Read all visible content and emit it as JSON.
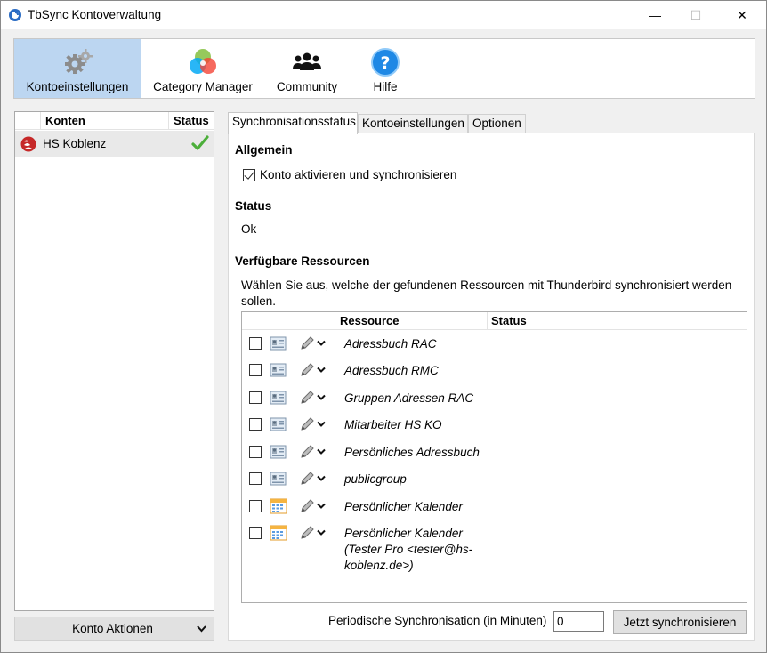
{
  "window": {
    "title": "TbSync Kontoverwaltung",
    "controls": {
      "minimize": "—",
      "maximize": "☐",
      "close": "✕"
    }
  },
  "toolbar": {
    "items": [
      {
        "label": "Kontoeinstellungen",
        "icon": "gears-icon",
        "active": true
      },
      {
        "label": "Category Manager",
        "icon": "color-circles-icon",
        "active": false
      },
      {
        "label": "Community",
        "icon": "people-icon",
        "active": false
      },
      {
        "label": "Hilfe",
        "icon": "help-icon",
        "active": false
      }
    ]
  },
  "accounts": {
    "columns": {
      "name": "Konten",
      "status": "Status"
    },
    "rows": [
      {
        "name": "HS Koblenz",
        "status_icon": "checkmark-icon"
      }
    ],
    "actions_label": "Konto Aktionen"
  },
  "tabs": [
    {
      "label": "Synchronisationsstatus",
      "selected": true
    },
    {
      "label": "Kontoeinstellungen",
      "selected": false
    },
    {
      "label": "Optionen",
      "selected": false
    }
  ],
  "sync": {
    "general_heading": "Allgemein",
    "enable_label": "Konto aktivieren und synchronisieren",
    "enable_checked": true,
    "status_heading": "Status",
    "status_value": "Ok",
    "resources_heading": "Verfügbare Ressourcen",
    "resources_hint": "Wählen Sie aus, welche der gefundenen Ressourcen mit Thunderbird synchronisiert werden sollen.",
    "columns": {
      "resource": "Ressource",
      "status": "Status"
    },
    "resources": [
      {
        "name": "Adressbuch RAC",
        "type": "addressbook-icon",
        "checked": false
      },
      {
        "name": "Adressbuch RMC",
        "type": "addressbook-icon",
        "checked": false
      },
      {
        "name": "Gruppen Adressen RAC",
        "type": "addressbook-icon",
        "checked": false
      },
      {
        "name": "Mitarbeiter HS KO",
        "type": "addressbook-icon",
        "checked": false
      },
      {
        "name": "Persönliches Adressbuch",
        "type": "addressbook-icon",
        "checked": false
      },
      {
        "name": "publicgroup",
        "type": "addressbook-icon",
        "checked": false
      },
      {
        "name": "Persönlicher Kalender",
        "type": "calendar-icon",
        "checked": false
      },
      {
        "name": "Persönlicher Kalender (Tester Pro <tester@hs-koblenz.de>)",
        "type": "calendar-icon",
        "checked": false
      }
    ],
    "periodic_label": "Periodische Synchronisation (in Minuten)",
    "periodic_value": "0",
    "sync_now_label": "Jetzt synchronisieren"
  },
  "colors": {
    "active_toolbar": "#bcd6f1",
    "check_green": "#4caf3a",
    "account_logo_red": "#c62828",
    "help_blue": "#1e88e5"
  }
}
